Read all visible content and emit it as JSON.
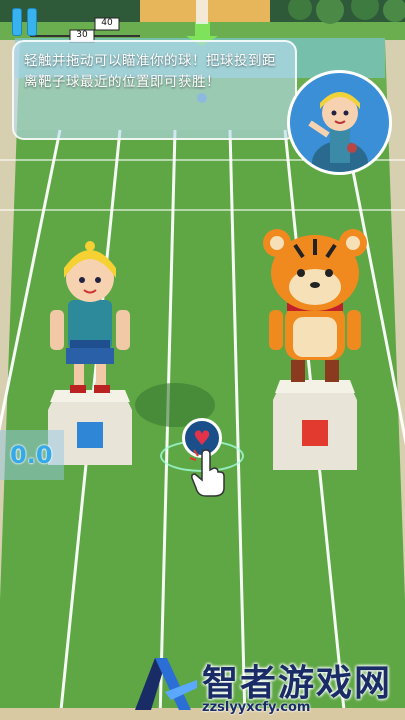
{
  "hud": {
    "distance_marker_30": "30",
    "distance_marker_40": "40",
    "score_value": "0.0"
  },
  "tip": {
    "text": "轻触并拖动可以瞄准你的球！把球投到距离靶子球最近的位置即可获胜！"
  },
  "watermark": {
    "title": "智者游戏网",
    "url": "zzslyyxcfy.com"
  },
  "colors": {
    "grass": "#5fa845",
    "lane_line": "#ffffff",
    "accent_blue": "#36a9ea",
    "pedestal_left": "#2f86d6",
    "pedestal_right": "#e23a2e"
  }
}
